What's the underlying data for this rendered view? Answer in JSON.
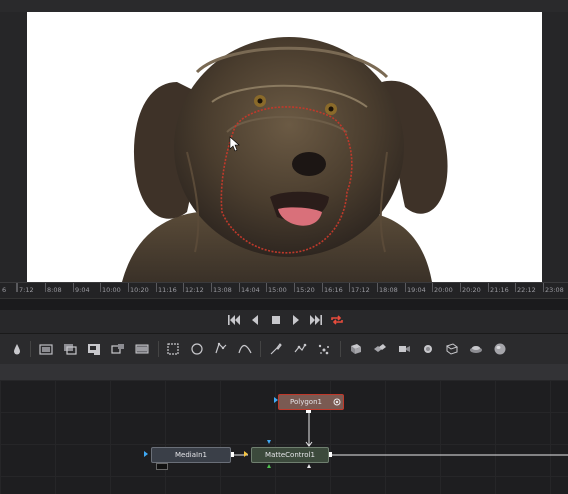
{
  "timeline": {
    "ticks": [
      "6",
      "7:12",
      "8:08",
      "9:04",
      "10:00",
      "10:20",
      "11:16",
      "12:12",
      "13:08",
      "14:04",
      "15:00",
      "15:20",
      "16:16",
      "17:12",
      "18:08",
      "19:04",
      "20:00",
      "20:20",
      "21:16",
      "22:12",
      "23:08"
    ]
  },
  "transport": {
    "buttons": [
      "skip-to-start",
      "step-back",
      "stop",
      "play",
      "skip-to-end",
      "loop"
    ]
  },
  "toolbar": {
    "tools": [
      "drop-icon",
      "background-icon",
      "merge-icon",
      "text-icon",
      "transform-icon",
      "blur-icon",
      "rectangle-icon",
      "ellipse-icon",
      "polygon-icon",
      "bspline-icon",
      "paint-icon",
      "tracker-icon",
      "particles-icon",
      "shape3d-icon",
      "merge3d-icon",
      "camera3d-icon",
      "light3d-icon",
      "render3d-icon",
      "fog3d-icon",
      "sphere-icon"
    ]
  },
  "nodes": {
    "polygon": "Polygon1",
    "media_in": "MediaIn1",
    "matte_control": "MatteControl1"
  },
  "colors": {
    "mask": "#c0392b",
    "polygon_node": "#7a5a52",
    "media_in_node": "#3a3f48",
    "matte_control_node": "#3c4a3c",
    "loop_active": "#e74c3c"
  }
}
